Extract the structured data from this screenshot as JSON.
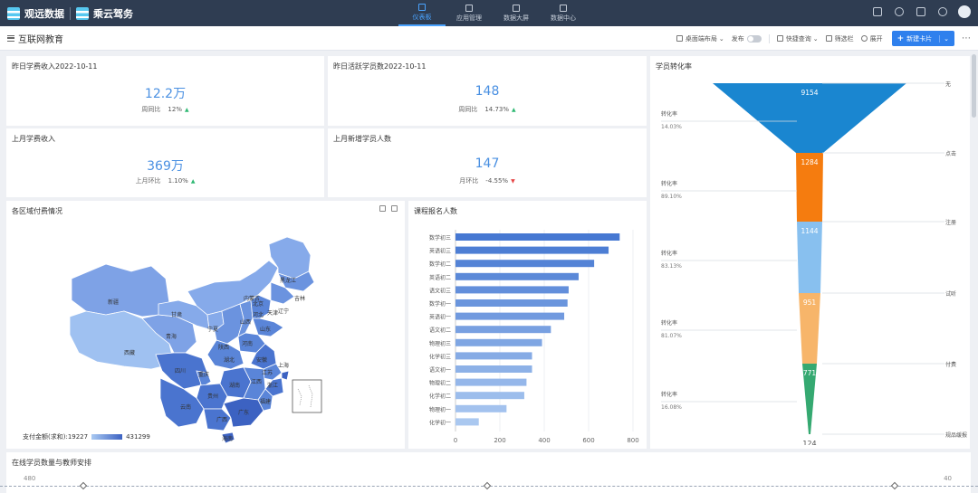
{
  "topbar": {
    "logo1": "观远数据",
    "logo2": "乘云驾务",
    "nav": [
      {
        "label": "仪表板",
        "active": true
      },
      {
        "label": "应用管理",
        "active": false
      },
      {
        "label": "数据大屏",
        "active": false
      },
      {
        "label": "数据中心",
        "active": false
      }
    ]
  },
  "page": {
    "title": "互联网教育",
    "tools": {
      "layout": "桌面端布局",
      "publish": "发布",
      "quick_query": "快捷查询",
      "filter": "筛选栏",
      "expand": "展开",
      "new_card": "新建卡片"
    }
  },
  "kpis": [
    {
      "title": "昨日学费收入2022-10-11",
      "value": "12.2万",
      "compare_label": "周同比",
      "compare_value": "12%",
      "trend": "up"
    },
    {
      "title": "昨日活跃学员数2022-10-11",
      "value": "148",
      "compare_label": "周同比",
      "compare_value": "14.73%",
      "trend": "up"
    },
    {
      "title": "上月学费收入",
      "value": "369万",
      "compare_label": "上月环比",
      "compare_value": "1.10%",
      "trend": "up"
    },
    {
      "title": "上月新增学员人数",
      "value": "147",
      "compare_label": "月环比",
      "compare_value": "-4.55%",
      "trend": "down"
    }
  ],
  "map": {
    "title": "各区域付费情况",
    "legend_label": "支付金额(求和):19227",
    "legend_max": "431299",
    "regions": [
      "新疆",
      "西藏",
      "青海",
      "甘肃",
      "内蒙古",
      "黑龙江",
      "吉林",
      "辽宁",
      "宁夏",
      "陕西",
      "山西",
      "河北",
      "北京",
      "天津",
      "山东",
      "河南",
      "四川",
      "重庆",
      "湖北",
      "安徽",
      "江苏",
      "上海",
      "浙江",
      "湖南",
      "江西",
      "贵州",
      "云南",
      "广西",
      "广东",
      "福建",
      "海南"
    ]
  },
  "chart_data": [
    {
      "type": "bar",
      "title": "课程报名人数",
      "categories": [
        "数学初三",
        "英语初三",
        "数学初二",
        "英语初二",
        "语文初三",
        "数学初一",
        "英语初一",
        "语文初二",
        "物理初三",
        "化学初三",
        "语文初一",
        "物理初二",
        "化学初二",
        "物理初一",
        "化学初一"
      ],
      "values": [
        740,
        690,
        625,
        555,
        510,
        505,
        490,
        430,
        390,
        345,
        345,
        320,
        310,
        230,
        105
      ],
      "xlim": [
        0,
        800
      ],
      "xticks": [
        "0",
        "200",
        "400",
        "600",
        "800"
      ]
    },
    {
      "type": "funnel",
      "title": "学员转化率",
      "stages": [
        "无",
        "点击",
        "注册",
        "试听",
        "付费",
        "规品缓报"
      ],
      "values": [
        9154,
        1284,
        1144,
        951,
        771,
        124
      ],
      "colors": [
        "#1a86d0",
        "#f57c0f",
        "#88c0ef",
        "#f7b56a",
        "#35a971",
        "#35a971"
      ],
      "conversion_label": "转化率",
      "conversions": [
        "14.03%",
        "89.10%",
        "83.13%",
        "81.07%",
        "16.08%"
      ]
    }
  ],
  "bottom": {
    "title": "在线学员数量与教师安排",
    "left_axis_top": "480",
    "right_axis_top": "40"
  }
}
